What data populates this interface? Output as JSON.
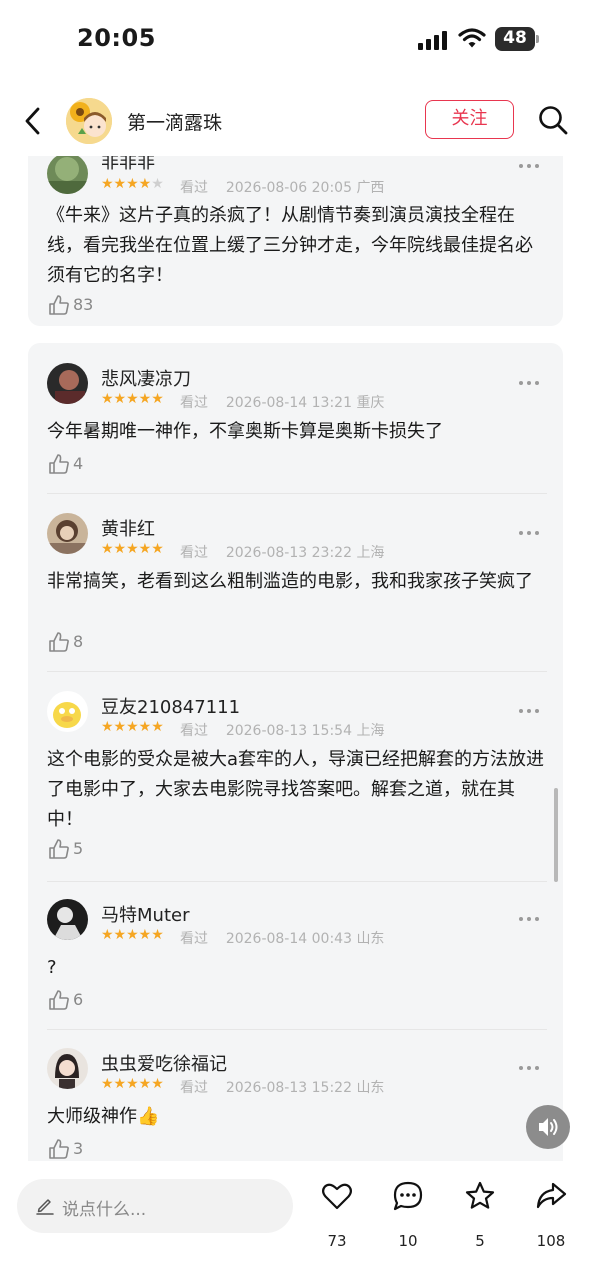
{
  "status_bar": {
    "time": "20:05",
    "battery": "48"
  },
  "header": {
    "name": "第一滴露珠",
    "follow_label": "关注"
  },
  "comments": [
    {
      "name": "非非非",
      "rating": 4,
      "watched": "看过",
      "date": "2026-08-06 20:05",
      "region": "广西",
      "text": "《牛来》这片子真的杀疯了！从剧情节奏到演员演技全程在线，看完我坐在位置上缓了三分钟才走，今年院线最佳提名必须有它的名字！",
      "likes": "83"
    },
    {
      "name": "悲风凄凉刀",
      "rating": 5,
      "watched": "看过",
      "date": "2026-08-14 13:21",
      "region": "重庆",
      "text": "今年暑期唯一神作，不拿奥斯卡算是奥斯卡损失了",
      "likes": "4"
    },
    {
      "name": "黄非红",
      "rating": 5,
      "watched": "看过",
      "date": "2026-08-13 23:22",
      "region": "上海",
      "text": "非常搞笑，老看到这么粗制滥造的电影，我和我家孩子笑疯了",
      "likes": "8"
    },
    {
      "name": "豆友210847111",
      "rating": 5,
      "watched": "看过",
      "date": "2026-08-13 15:54",
      "region": "上海",
      "text": "这个电影的受众是被大a套牢的人，导演已经把解套的方法放进了电影中了，大家去电影院寻找答案吧。解套之道，就在其中！",
      "likes": "5"
    },
    {
      "name": "马特Muter",
      "rating": 5,
      "watched": "看过",
      "date": "2026-08-14 00:43",
      "region": "山东",
      "text": "?",
      "likes": "6"
    },
    {
      "name": "虫虫爱吃徐福记",
      "rating": 5,
      "watched": "看过",
      "date": "2026-08-13 15:22",
      "region": "山东",
      "text": "大师级神作👍",
      "likes": "3"
    }
  ],
  "bottom_bar": {
    "input_placeholder": "说点什么...",
    "like_count": "73",
    "comment_count": "10",
    "favorite_count": "5",
    "share_count": "108"
  },
  "colors": {
    "accent": "#e8364f",
    "star": "#f5a623",
    "card_bg": "#f4f5f6"
  },
  "icons": [
    "back-icon",
    "search-icon",
    "more-icon",
    "thumbs-up-icon",
    "pen-icon",
    "heart-icon",
    "comment-bubble-icon",
    "star-icon",
    "share-icon",
    "speaker-icon"
  ]
}
